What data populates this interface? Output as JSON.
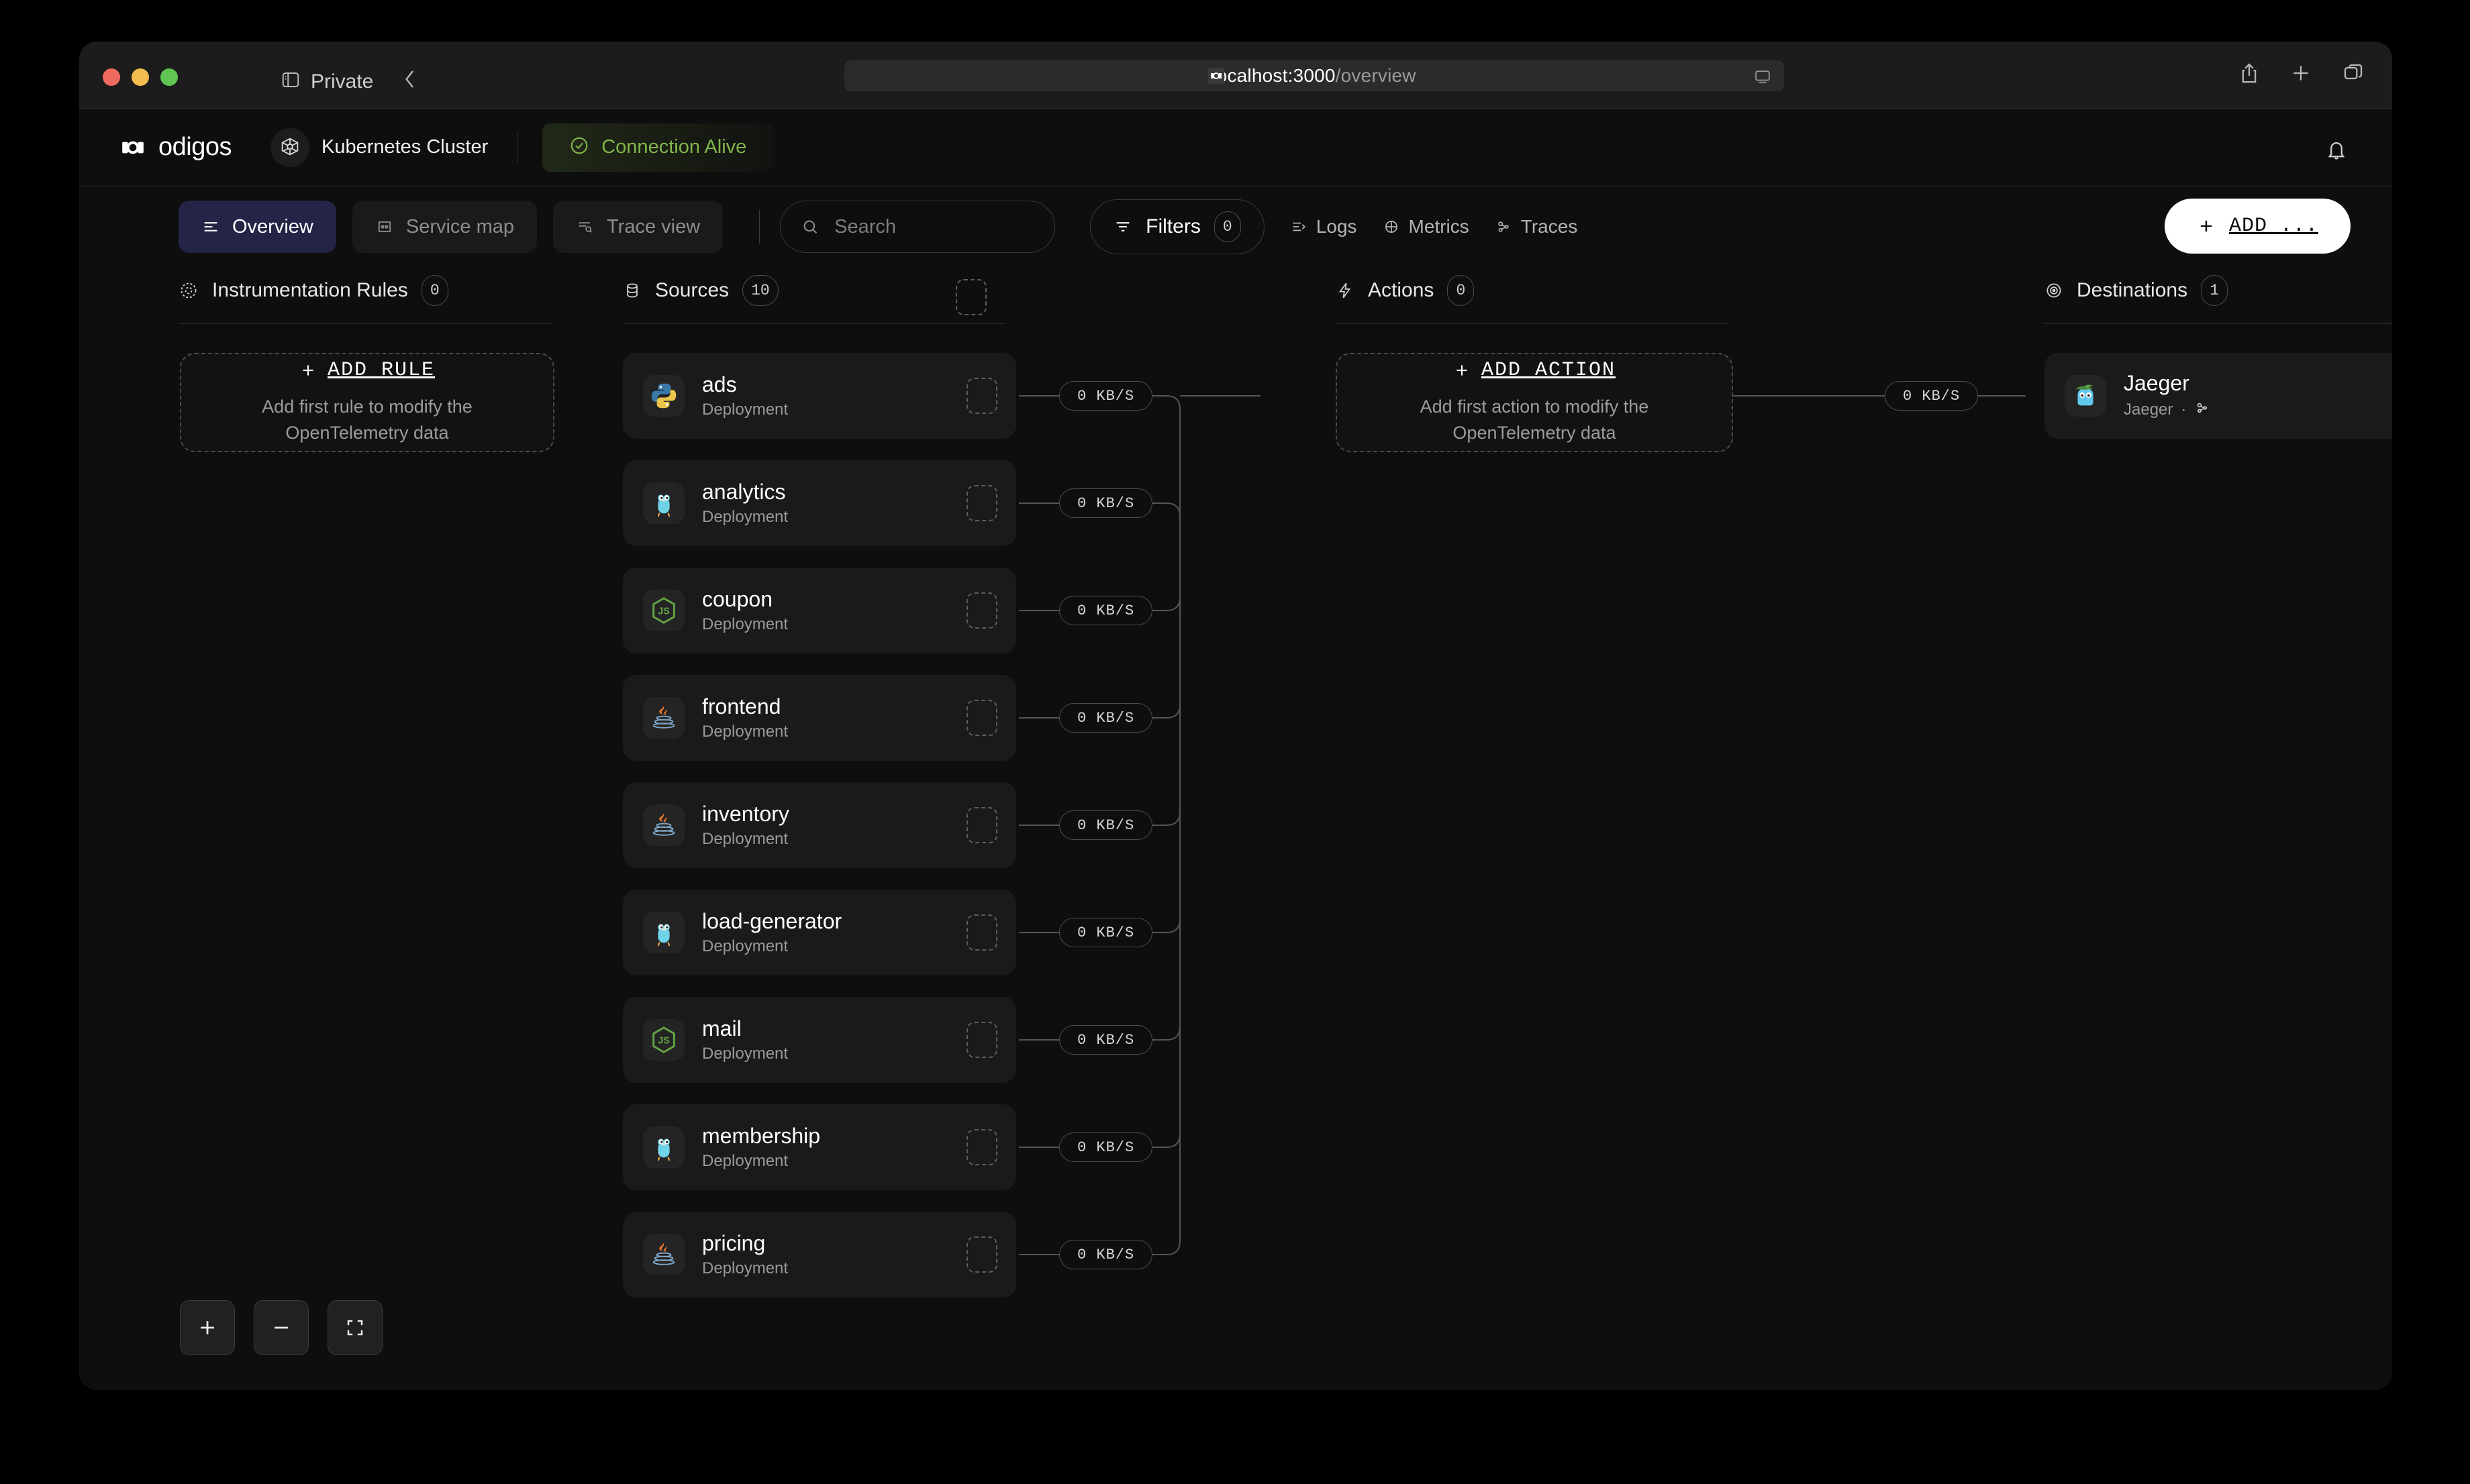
{
  "browser": {
    "private_label": "Private",
    "url_host": "localhost:3000",
    "url_path": "/overview",
    "icons": {
      "sidebar": "sidebar-icon",
      "back": "back-chevron-icon",
      "share": "share-icon",
      "new_tab": "plus-icon",
      "tabs": "tab-overview-icon",
      "reader": "reader-icon"
    }
  },
  "header": {
    "brand": "odigos",
    "cluster": "Kubernetes Cluster",
    "connection_status": "Connection Alive",
    "connection_color": "#81b64a"
  },
  "toolbar": {
    "tabs": [
      {
        "label": "Overview",
        "active": true
      },
      {
        "label": "Service map",
        "active": false
      },
      {
        "label": "Trace view",
        "active": false
      }
    ],
    "search_placeholder": "Search",
    "search_value": "",
    "filters_label": "Filters",
    "filters_count": "0",
    "signals": [
      {
        "label": "Logs"
      },
      {
        "label": "Metrics"
      },
      {
        "label": "Traces"
      }
    ],
    "add_label": "ADD ..."
  },
  "columns": [
    {
      "title": "Instrumentation Rules",
      "count": "0"
    },
    {
      "title": "Sources",
      "count": "10"
    },
    {
      "title": "Actions",
      "count": "0"
    },
    {
      "title": "Destinations",
      "count": "1"
    }
  ],
  "empty_states": {
    "rule": {
      "cta": "ADD RULE",
      "desc": "Add first rule to modify the OpenTelemetry data"
    },
    "action": {
      "cta": "ADD ACTION",
      "desc": "Add first action to modify the OpenTelemetry data"
    }
  },
  "sources": [
    {
      "name": "ads",
      "kind": "Deployment",
      "lang": "python"
    },
    {
      "name": "analytics",
      "kind": "Deployment",
      "lang": "go"
    },
    {
      "name": "coupon",
      "kind": "Deployment",
      "lang": "nodejs"
    },
    {
      "name": "frontend",
      "kind": "Deployment",
      "lang": "java"
    },
    {
      "name": "inventory",
      "kind": "Deployment",
      "lang": "java"
    },
    {
      "name": "load-generator",
      "kind": "Deployment",
      "lang": "go"
    },
    {
      "name": "mail",
      "kind": "Deployment",
      "lang": "nodejs"
    },
    {
      "name": "membership",
      "kind": "Deployment",
      "lang": "go"
    },
    {
      "name": "pricing",
      "kind": "Deployment",
      "lang": "java"
    }
  ],
  "destinations": [
    {
      "name": "Jaeger",
      "sub": "Jaeger",
      "separator": "·",
      "signal_icon": "traces-icon"
    }
  ],
  "edges": {
    "source_rates": [
      "0 KB/S",
      "0 KB/S",
      "0 KB/S",
      "0 KB/S",
      "0 KB/S",
      "0 KB/S",
      "0 KB/S",
      "0 KB/S",
      "0 KB/S"
    ],
    "destination_rate": "0 KB/S"
  },
  "zoom_controls": [
    {
      "name": "zoom-in",
      "glyph": "+"
    },
    {
      "name": "zoom-out",
      "glyph": "−"
    },
    {
      "name": "fit-view",
      "glyph": "fit"
    }
  ]
}
